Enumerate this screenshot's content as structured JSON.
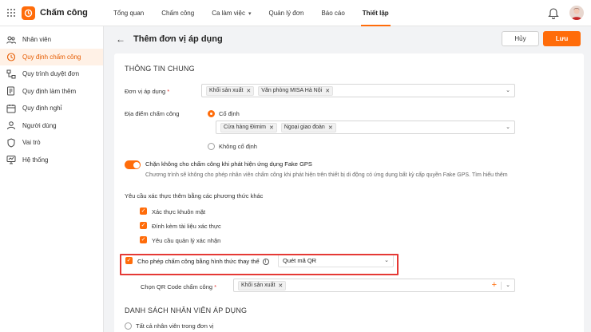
{
  "app": {
    "title": "Chấm công"
  },
  "nav": [
    {
      "label": "Tổng quan"
    },
    {
      "label": "Chấm công"
    },
    {
      "label": "Ca làm việc"
    },
    {
      "label": "Quản lý đơn"
    },
    {
      "label": "Báo cáo"
    },
    {
      "label": "Thiết lập"
    }
  ],
  "sidebar": {
    "items": [
      {
        "label": "Nhân viên",
        "icon": "users-icon"
      },
      {
        "label": "Quy định chấm công",
        "icon": "clock-icon"
      },
      {
        "label": "Quy trình duyệt đơn",
        "icon": "workflow-icon"
      },
      {
        "label": "Quy định làm thêm",
        "icon": "overtime-icon"
      },
      {
        "label": "Quy định nghỉ",
        "icon": "calendar-icon"
      },
      {
        "label": "Người dùng",
        "icon": "user-icon"
      },
      {
        "label": "Vai trò",
        "icon": "shield-icon"
      },
      {
        "label": "Hệ thống",
        "icon": "system-icon"
      }
    ]
  },
  "header": {
    "title": "Thêm đơn vị áp dụng",
    "cancel_label": "Hủy",
    "save_label": "Lưu"
  },
  "general": {
    "section_title": "THÔNG TIN CHUNG",
    "unit_label": "Đơn vị áp dụng",
    "unit_required": "*",
    "unit_tags": [
      "Khối sản xuất",
      "Văn phòng MISA Hà Nội"
    ],
    "location_label": "Địa điểm chấm công",
    "fixed_label": "Cố định",
    "location_tags": [
      "Cửa hàng Đimim",
      "Ngoại giao đoàn"
    ],
    "not_fixed_label": "Không cố định",
    "fake_gps_title": "Chặn không cho chấm công khi phát hiện ứng dụng Fake GPS",
    "fake_gps_desc": "Chương trình sẽ không cho phép nhân viên chấm công khi phát hiện trên thiết bị di động có ứng dụng bất kỳ cấp quyền Fake GPS. Tìm hiểu thêm",
    "extra_verify_label": "Yêu cầu xác thực thêm bằng các phương thức khác",
    "verify_options": [
      "Xác thực khuôn mặt",
      "Đính kèm tài liệu xác thực",
      "Yêu cầu quản lý xác nhận"
    ],
    "alt_method_label": "Cho phép chấm công bằng hình thức thay thế",
    "alt_method_value": "Quét mã QR",
    "qr_label": "Chọn QR Code chấm công",
    "qr_required": "*",
    "qr_tags": [
      "Khối sản xuất"
    ]
  },
  "employees": {
    "section_title": "DANH SÁCH NHÂN VIÊN ÁP DỤNG",
    "all_label": "Tất cả nhân viên trong đơn vị"
  },
  "colors": {
    "accent": "#ff6c0a",
    "highlight": "#e53935"
  }
}
